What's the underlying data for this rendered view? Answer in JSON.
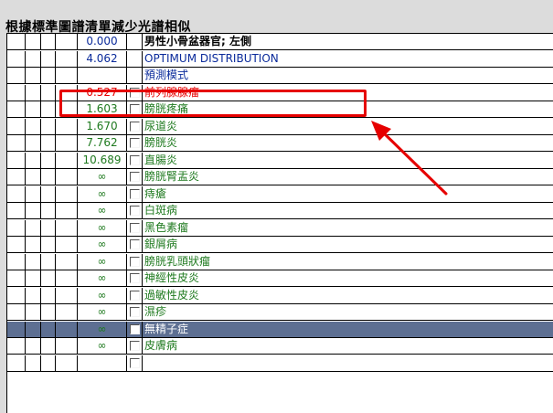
{
  "title": "根據標準圖譜清單減少光譜相似",
  "rows": [
    {
      "value": "0.000",
      "label": "男性小骨盆器官; 左側",
      "value_color": "blue",
      "label_color": "black",
      "bold": true,
      "has_checkbox": false
    },
    {
      "value": "4.062",
      "label": "OPTIMUM DISTRIBUTION",
      "value_color": "blue",
      "label_color": "blue",
      "bold": false,
      "has_checkbox": false
    },
    {
      "value": "",
      "label": "預測模式",
      "value_color": "blue",
      "label_color": "blue",
      "bold": false,
      "has_checkbox": false
    },
    {
      "value": "0.527",
      "label": "前列腺腺瘤",
      "value_color": "red",
      "label_color": "red",
      "bold": false,
      "has_checkbox": true
    },
    {
      "value": "1.603",
      "label": "膀胱疼痛",
      "value_color": "green",
      "label_color": "green",
      "bold": false,
      "has_checkbox": true
    },
    {
      "value": "1.670",
      "label": "尿道炎",
      "value_color": "green",
      "label_color": "green",
      "bold": false,
      "has_checkbox": true
    },
    {
      "value": "7.762",
      "label": "膀胱炎",
      "value_color": "green",
      "label_color": "green",
      "bold": false,
      "has_checkbox": true
    },
    {
      "value": "10.689",
      "label": "直腸炎",
      "value_color": "green",
      "label_color": "green",
      "bold": false,
      "has_checkbox": true
    },
    {
      "value": "∞",
      "label": "膀胱腎盂炎",
      "value_color": "green",
      "label_color": "green",
      "bold": false,
      "has_checkbox": true
    },
    {
      "value": "∞",
      "label": "痔瘡",
      "value_color": "green",
      "label_color": "green",
      "bold": false,
      "has_checkbox": true
    },
    {
      "value": "∞",
      "label": "白斑病",
      "value_color": "green",
      "label_color": "green",
      "bold": false,
      "has_checkbox": true
    },
    {
      "value": "∞",
      "label": "黑色素瘤",
      "value_color": "green",
      "label_color": "green",
      "bold": false,
      "has_checkbox": true
    },
    {
      "value": "∞",
      "label": "銀屑病",
      "value_color": "green",
      "label_color": "green",
      "bold": false,
      "has_checkbox": true
    },
    {
      "value": "∞",
      "label": "膀胱乳頭狀瘤",
      "value_color": "green",
      "label_color": "green",
      "bold": false,
      "has_checkbox": true
    },
    {
      "value": "∞",
      "label": "神經性皮炎",
      "value_color": "green",
      "label_color": "green",
      "bold": false,
      "has_checkbox": true
    },
    {
      "value": "∞",
      "label": "過敏性皮炎",
      "value_color": "green",
      "label_color": "green",
      "bold": false,
      "has_checkbox": true
    },
    {
      "value": "∞",
      "label": "濕疹",
      "value_color": "green",
      "label_color": "green",
      "bold": false,
      "has_checkbox": true
    },
    {
      "value": "∞",
      "label": "無精子症",
      "value_color": "green",
      "label_color": "white",
      "bold": false,
      "has_checkbox": true,
      "selected": true
    },
    {
      "value": "∞",
      "label": "皮膚病",
      "value_color": "green",
      "label_color": "green",
      "bold": false,
      "has_checkbox": true
    },
    {
      "value": "",
      "label": "",
      "value_color": "green",
      "label_color": "green",
      "bold": false,
      "has_checkbox": true
    }
  ],
  "colors": {
    "highlight_box": "#e60000",
    "arrow": "#e60000",
    "selected_row": "#5d6f92"
  }
}
